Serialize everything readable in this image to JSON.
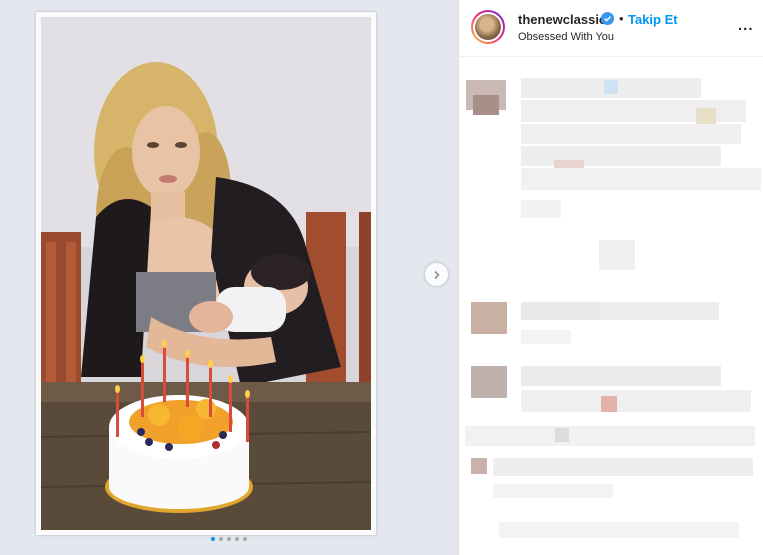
{
  "post": {
    "username": "thenewclassic",
    "bullet": "•",
    "follow_label": "Takip Et",
    "subtitle": "Obsessed With You",
    "more_label": "..."
  },
  "carousel": {
    "dot_count": 5,
    "active_index": 0
  },
  "colors": {
    "accent": "#0095f6",
    "text": "#262626",
    "blurred": "#ececec"
  },
  "icons": {
    "verified": "verified-badge-icon",
    "next": "chevron-right-icon"
  }
}
